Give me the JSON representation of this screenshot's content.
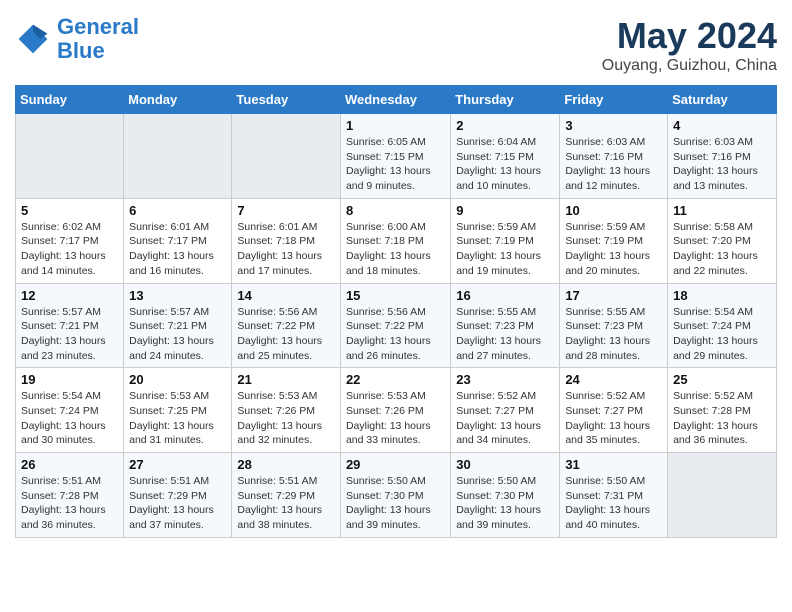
{
  "header": {
    "logo_line1": "General",
    "logo_line2": "Blue",
    "main_title": "May 2024",
    "subtitle": "Ouyang, Guizhou, China"
  },
  "weekdays": [
    "Sunday",
    "Monday",
    "Tuesday",
    "Wednesday",
    "Thursday",
    "Friday",
    "Saturday"
  ],
  "weeks": [
    [
      {
        "num": "",
        "detail": ""
      },
      {
        "num": "",
        "detail": ""
      },
      {
        "num": "",
        "detail": ""
      },
      {
        "num": "1",
        "detail": "Sunrise: 6:05 AM\nSunset: 7:15 PM\nDaylight: 13 hours\nand 9 minutes."
      },
      {
        "num": "2",
        "detail": "Sunrise: 6:04 AM\nSunset: 7:15 PM\nDaylight: 13 hours\nand 10 minutes."
      },
      {
        "num": "3",
        "detail": "Sunrise: 6:03 AM\nSunset: 7:16 PM\nDaylight: 13 hours\nand 12 minutes."
      },
      {
        "num": "4",
        "detail": "Sunrise: 6:03 AM\nSunset: 7:16 PM\nDaylight: 13 hours\nand 13 minutes."
      }
    ],
    [
      {
        "num": "5",
        "detail": "Sunrise: 6:02 AM\nSunset: 7:17 PM\nDaylight: 13 hours\nand 14 minutes."
      },
      {
        "num": "6",
        "detail": "Sunrise: 6:01 AM\nSunset: 7:17 PM\nDaylight: 13 hours\nand 16 minutes."
      },
      {
        "num": "7",
        "detail": "Sunrise: 6:01 AM\nSunset: 7:18 PM\nDaylight: 13 hours\nand 17 minutes."
      },
      {
        "num": "8",
        "detail": "Sunrise: 6:00 AM\nSunset: 7:18 PM\nDaylight: 13 hours\nand 18 minutes."
      },
      {
        "num": "9",
        "detail": "Sunrise: 5:59 AM\nSunset: 7:19 PM\nDaylight: 13 hours\nand 19 minutes."
      },
      {
        "num": "10",
        "detail": "Sunrise: 5:59 AM\nSunset: 7:19 PM\nDaylight: 13 hours\nand 20 minutes."
      },
      {
        "num": "11",
        "detail": "Sunrise: 5:58 AM\nSunset: 7:20 PM\nDaylight: 13 hours\nand 22 minutes."
      }
    ],
    [
      {
        "num": "12",
        "detail": "Sunrise: 5:57 AM\nSunset: 7:21 PM\nDaylight: 13 hours\nand 23 minutes."
      },
      {
        "num": "13",
        "detail": "Sunrise: 5:57 AM\nSunset: 7:21 PM\nDaylight: 13 hours\nand 24 minutes."
      },
      {
        "num": "14",
        "detail": "Sunrise: 5:56 AM\nSunset: 7:22 PM\nDaylight: 13 hours\nand 25 minutes."
      },
      {
        "num": "15",
        "detail": "Sunrise: 5:56 AM\nSunset: 7:22 PM\nDaylight: 13 hours\nand 26 minutes."
      },
      {
        "num": "16",
        "detail": "Sunrise: 5:55 AM\nSunset: 7:23 PM\nDaylight: 13 hours\nand 27 minutes."
      },
      {
        "num": "17",
        "detail": "Sunrise: 5:55 AM\nSunset: 7:23 PM\nDaylight: 13 hours\nand 28 minutes."
      },
      {
        "num": "18",
        "detail": "Sunrise: 5:54 AM\nSunset: 7:24 PM\nDaylight: 13 hours\nand 29 minutes."
      }
    ],
    [
      {
        "num": "19",
        "detail": "Sunrise: 5:54 AM\nSunset: 7:24 PM\nDaylight: 13 hours\nand 30 minutes."
      },
      {
        "num": "20",
        "detail": "Sunrise: 5:53 AM\nSunset: 7:25 PM\nDaylight: 13 hours\nand 31 minutes."
      },
      {
        "num": "21",
        "detail": "Sunrise: 5:53 AM\nSunset: 7:26 PM\nDaylight: 13 hours\nand 32 minutes."
      },
      {
        "num": "22",
        "detail": "Sunrise: 5:53 AM\nSunset: 7:26 PM\nDaylight: 13 hours\nand 33 minutes."
      },
      {
        "num": "23",
        "detail": "Sunrise: 5:52 AM\nSunset: 7:27 PM\nDaylight: 13 hours\nand 34 minutes."
      },
      {
        "num": "24",
        "detail": "Sunrise: 5:52 AM\nSunset: 7:27 PM\nDaylight: 13 hours\nand 35 minutes."
      },
      {
        "num": "25",
        "detail": "Sunrise: 5:52 AM\nSunset: 7:28 PM\nDaylight: 13 hours\nand 36 minutes."
      }
    ],
    [
      {
        "num": "26",
        "detail": "Sunrise: 5:51 AM\nSunset: 7:28 PM\nDaylight: 13 hours\nand 36 minutes."
      },
      {
        "num": "27",
        "detail": "Sunrise: 5:51 AM\nSunset: 7:29 PM\nDaylight: 13 hours\nand 37 minutes."
      },
      {
        "num": "28",
        "detail": "Sunrise: 5:51 AM\nSunset: 7:29 PM\nDaylight: 13 hours\nand 38 minutes."
      },
      {
        "num": "29",
        "detail": "Sunrise: 5:50 AM\nSunset: 7:30 PM\nDaylight: 13 hours\nand 39 minutes."
      },
      {
        "num": "30",
        "detail": "Sunrise: 5:50 AM\nSunset: 7:30 PM\nDaylight: 13 hours\nand 39 minutes."
      },
      {
        "num": "31",
        "detail": "Sunrise: 5:50 AM\nSunset: 7:31 PM\nDaylight: 13 hours\nand 40 minutes."
      },
      {
        "num": "",
        "detail": ""
      }
    ]
  ]
}
